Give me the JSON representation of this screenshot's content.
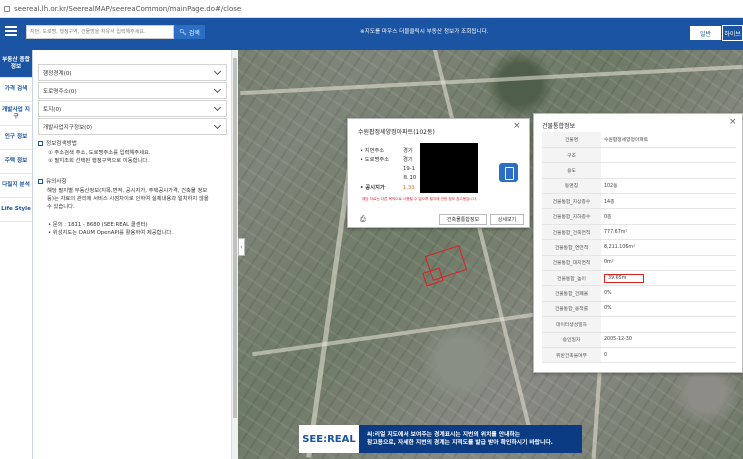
{
  "browser": {
    "url": "seereal.lh.or.kr/SeerealMAP/seereaCommon/mainPage.do#/close"
  },
  "header": {
    "search_placeholder": "지번, 도로명, 행정구역, 건물명을 자유서 입력해주세요.",
    "search_button": "검색",
    "notice": "※지도를 마우스 더블클릭시 부동산 정보가 조회됩니다.",
    "map_types": [
      "일반",
      "하이브"
    ]
  },
  "left_nav": [
    {
      "label": "부동산 종합정보",
      "active": true
    },
    {
      "label": "가격 검색"
    },
    {
      "label": "개발사업 지구"
    },
    {
      "label": "인구 정보"
    },
    {
      "label": "주택 정보"
    },
    {
      "label": "다필지 분석"
    },
    {
      "label": "Life Style"
    }
  ],
  "panel": {
    "accordions": [
      "행정경계(0)",
      "도로명주소(0)",
      "토지(0)",
      "개발사업지구정보(0)"
    ],
    "usage_title": "정보검색방법",
    "usage_items": [
      "① 주소검색 주소, 도로명주소를 입력해주세요.",
      "② 필지조회 선택된 행정구역으로 이동합니다."
    ],
    "caution_title": "유의사항",
    "caution_text": [
      "해당 필지별 부동산정보(지목,면적, 공시지가, 주택공시가격, 건축물 정보",
      "등)는 자료의 관리에 서비스 시점차이로 인하여 실제내용과 일치하지 않을",
      "수 있습니다."
    ],
    "contact": "• 문의 : 1811 - 8680 (SEE:REAL 콜센터)",
    "source": "• 위성지도는 DAUM OpenAPI를 활용하여 제공합니다."
  },
  "popup": {
    "title": "수원팝정세양정아파트(102동)",
    "rows": [
      {
        "label": "• 지번주소",
        "value": "경기"
      },
      {
        "label": "• 도로명주소",
        "value": "경기"
      },
      {
        "label": "",
        "value": "19-1"
      },
      {
        "label": "",
        "value": "트 10"
      },
      {
        "label": "• 공시지가",
        "value": "1,33"
      }
    ],
    "small_note": "해당 자료는 다른 목적으로 사용될 수 없으며 필지에 관한 정보 참고용입니다.",
    "buttons": [
      "건축물통합정보",
      "상세보기"
    ]
  },
  "right_panel": {
    "title": "건물통합정보",
    "rows": [
      {
        "k": "건물명",
        "v": "수원팝정세양정아파트"
      },
      {
        "k": "구조",
        "v": ""
      },
      {
        "k": "용도",
        "v": ""
      },
      {
        "k": "동명칭",
        "v": "102동"
      },
      {
        "k": "건물통합_지상층수",
        "v": "14층"
      },
      {
        "k": "건물통합_지하층수",
        "v": "0층"
      },
      {
        "k": "건물통합_건축면적",
        "v": "777.67m²"
      },
      {
        "k": "건물통합_연면적",
        "v": "8,211.106m²"
      },
      {
        "k": "건물통합_대지면적",
        "v": "0m²"
      },
      {
        "k": "건물통합_높이",
        "v": "39.65m"
      },
      {
        "k": "건물통합_건폐율",
        "v": "0%"
      },
      {
        "k": "건물통합_용적률",
        "v": "0%"
      },
      {
        "k": "데이터생성일자",
        "v": ""
      },
      {
        "k": "승인일자",
        "v": "2005-12-30"
      },
      {
        "k": "위반건축물여부",
        "v": "0"
      }
    ]
  },
  "banner": {
    "logo": "SEE:REAL",
    "line1": "씨:리얼 지도에서 보여주는 경계표시는 지번의 위치를 안내하는",
    "line2": "참고용으로, 자세한 지번의 경계는 지적도를 발급 받아 확인하시기 바랍니다."
  },
  "colors": {
    "brand": "#1a54a2",
    "highlight": "#e02020"
  }
}
